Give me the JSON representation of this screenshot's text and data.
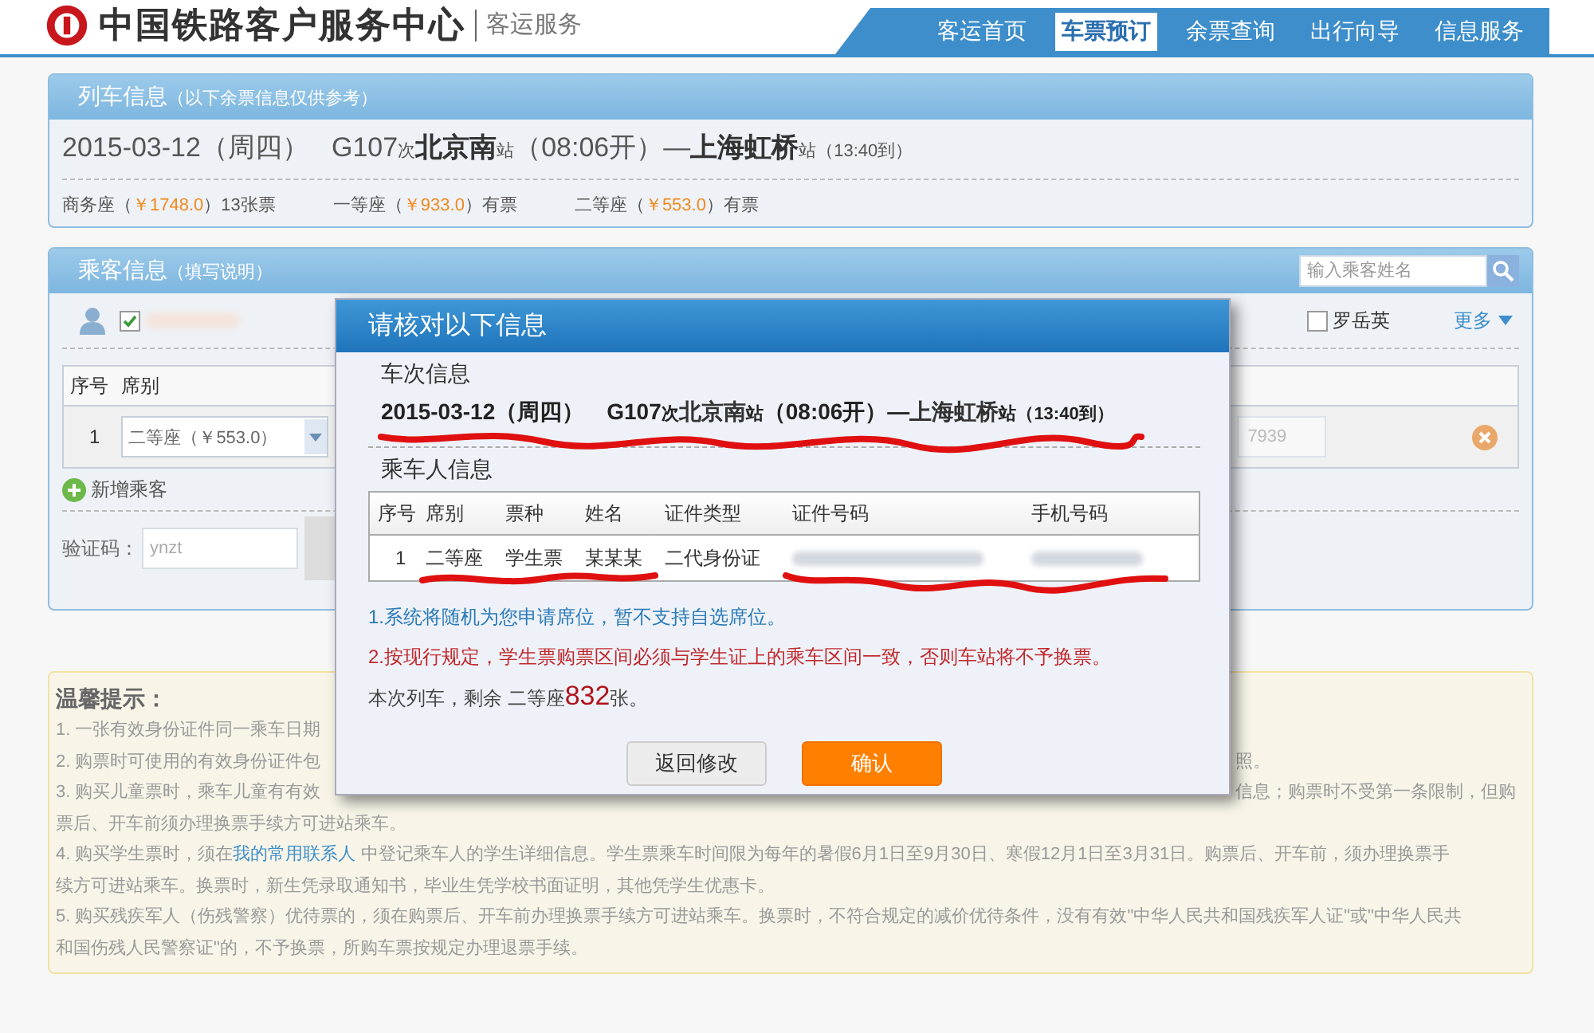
{
  "header": {
    "title": "中国铁路客户服务中心",
    "subtitle": "客运服务",
    "nav": [
      {
        "label": "客运首页",
        "selected": false
      },
      {
        "label": "车票预订",
        "selected": true
      },
      {
        "label": "余票查询",
        "selected": false
      },
      {
        "label": "出行向导",
        "selected": false
      },
      {
        "label": "信息服务",
        "selected": false
      }
    ]
  },
  "train_panel": {
    "title": "列车信息",
    "note": "（以下余票信息仅供参考）",
    "route": [
      {
        "text": "2015-03-12（周四）",
        "kind": "plain"
      },
      {
        "text": "G107",
        "kind": "train"
      },
      {
        "text": "次",
        "kind": "small"
      },
      {
        "text": "北京南",
        "kind": "bold"
      },
      {
        "text": "站",
        "kind": "small"
      },
      {
        "text": "（08:06开）—",
        "kind": "plain"
      },
      {
        "text": "上海虹桥",
        "kind": "bold"
      },
      {
        "text": "站",
        "kind": "small"
      },
      {
        "text": "（13:40到）",
        "kind": "small"
      }
    ],
    "seats": [
      {
        "class": "商务座（",
        "price": "￥1748.0",
        "availability": "）13张票"
      },
      {
        "class": "一等座（",
        "price": "￥933.0",
        "availability": "）有票"
      },
      {
        "class": "二等座（",
        "price": "￥553.0",
        "availability": "）有票"
      }
    ]
  },
  "passenger_panel": {
    "title": "乘客信息",
    "note": "（填写说明）",
    "search": {
      "placeholder": "输入乘客姓名"
    },
    "contacts": [
      {
        "checked": true
      },
      {
        "name": "罗岳英",
        "checked": false
      }
    ],
    "more": "更多",
    "columns": [
      "序号",
      "席别"
    ],
    "rows": [
      {
        "index": "1",
        "seat": "二等座（￥553.0）",
        "id_tail": "7939"
      }
    ],
    "add_passenger": "新增乘客",
    "captcha": {
      "label": "验证码：",
      "placeholder": "ynzt"
    }
  },
  "dialog": {
    "title": "请核对以下信息",
    "train_heading": "车次信息",
    "route": [
      {
        "text": "2015-03-12（周四）",
        "kind": "plain"
      },
      {
        "text": "G107",
        "kind": "train"
      },
      {
        "text": "次",
        "kind": "small"
      },
      {
        "text": "北京南",
        "kind": "bold"
      },
      {
        "text": "站",
        "kind": "small"
      },
      {
        "text": "（08:06开）—",
        "kind": "plain"
      },
      {
        "text": "上海虹桥",
        "kind": "bold"
      },
      {
        "text": "站",
        "kind": "small"
      },
      {
        "text": "（13:40到）",
        "kind": "small"
      }
    ],
    "passenger_heading": "乘车人信息",
    "columns": [
      "序号",
      "席别",
      "票种",
      "姓名",
      "证件类型",
      "证件号码",
      "手机号码"
    ],
    "rows": [
      {
        "cells": [
          "1",
          "二等座",
          "学生票",
          "某某某",
          "二代身份证"
        ]
      }
    ],
    "notes": [
      {
        "text": "1.系统将随机为您申请席位，暂不支持自选席位。",
        "kind": "info"
      },
      {
        "text": "2.按现行规定，学生票购票区间必须与学生证上的乘车区间一致，否则车站将不予换票。",
        "kind": "warning"
      }
    ],
    "remaining": [
      {
        "text": "本次列车，剩余 二等座",
        "kind": "plain"
      },
      {
        "text": "832",
        "kind": "count"
      },
      {
        "text": "张。",
        "kind": "plain"
      }
    ],
    "buttons": [
      {
        "label": "返回修改",
        "kind": "secondary"
      },
      {
        "label": "确认",
        "kind": "primary"
      }
    ]
  },
  "tips": {
    "title": "温馨提示：",
    "lines": [
      {
        "covered": true,
        "parts": [
          {
            "text": "1. 一张有效身份证件同一乘车日期"
          }
        ]
      },
      {
        "covered": true,
        "parts": [
          {
            "text": "2. 购票时可使用的有效身份证件包"
          }
        ],
        "after": "照。"
      },
      {
        "covered": true,
        "parts": [
          {
            "text": "3. 购买儿童票时，乘车儿童有有效"
          }
        ],
        "after": "信息；购票时不受第一条限制，但购"
      },
      {
        "covered": false,
        "parts": [
          {
            "text": "票后、开车前须办理换票手续方可进站乘车。"
          }
        ]
      },
      {
        "covered": false,
        "parts": [
          {
            "text": "4. 购买学生票时，须在"
          },
          {
            "text": "我的常用联系人",
            "kind": "link"
          },
          {
            "text": " 中登记乘车人的学生详细信息。学生票乘车时间限为每年的暑假6月1日至9月30日、寒假12月1日至3月31日。购票后、开车前，须办理换票手"
          }
        ]
      },
      {
        "covered": false,
        "parts": [
          {
            "text": "续方可进站乘车。换票时，新生凭录取通知书，毕业生凭学校书面证明，其他凭学生优惠卡。"
          }
        ]
      },
      {
        "covered": false,
        "parts": [
          {
            "text": "5. 购买残疾军人（伤残警察）优待票的，须在购票后、开车前办理换票手续方可进站乘车。换票时，不符合规定的减价优待条件，没有有效\"中华人民共和国残疾军人证\"或\"中华人民共"
          }
        ]
      },
      {
        "covered": false,
        "parts": [
          {
            "text": "和国伤残人民警察证\"的，不予换票，所购车票按规定办理退票手续。"
          }
        ]
      }
    ]
  }
}
